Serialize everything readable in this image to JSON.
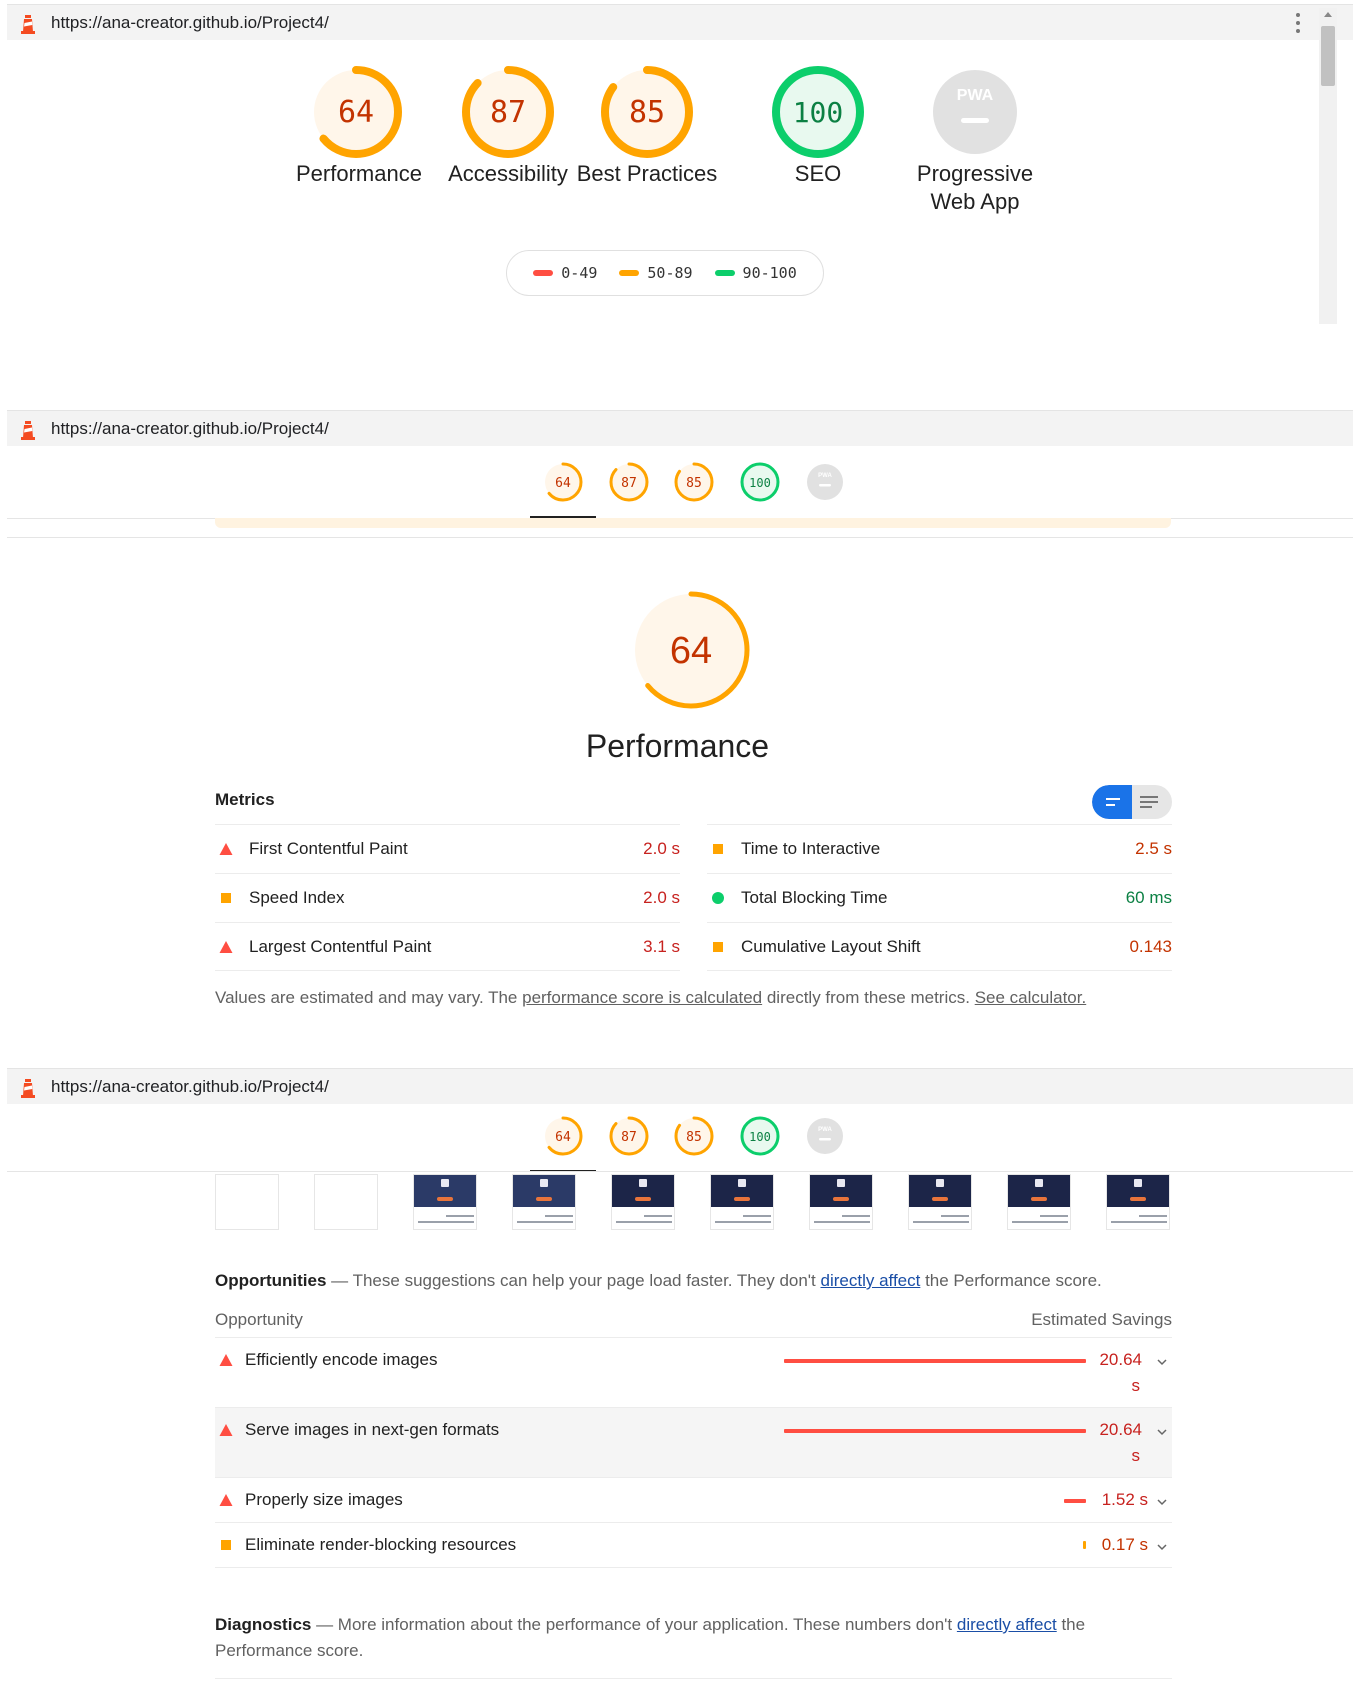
{
  "browser": {
    "url": "https://ana-creator.github.io/Project4/"
  },
  "scores": [
    {
      "value": 64,
      "display": "64",
      "label": "Performance",
      "color": "#ffa400"
    },
    {
      "value": 87,
      "display": "87",
      "label": "Accessibility",
      "color": "#ffa400"
    },
    {
      "value": 85,
      "display": "85",
      "label": "Best Practices",
      "color": "#ffa400"
    },
    {
      "value": 100,
      "display": "100",
      "label": "SEO",
      "color": "#0cce6b"
    },
    {
      "value": null,
      "display": "PWA",
      "label_line1": "Progressive",
      "label_line2": "Web App",
      "color": "#cccccc"
    }
  ],
  "legend": [
    {
      "range": "0-49",
      "color": "#ff4e42"
    },
    {
      "range": "50-89",
      "color": "#ffa400"
    },
    {
      "range": "90-100",
      "color": "#0cce6b"
    }
  ],
  "performance": {
    "score": "64",
    "score_value": 64,
    "title": "Performance",
    "metrics_heading": "Metrics",
    "metrics": [
      {
        "name": "First Contentful Paint",
        "value": "2.0 s",
        "status": "fail"
      },
      {
        "name": "Speed Index",
        "value": "2.0 s",
        "status": "average"
      },
      {
        "name": "Largest Contentful Paint",
        "value": "3.1 s",
        "status": "fail"
      },
      {
        "name": "Time to Interactive",
        "value": "2.5 s",
        "status": "average"
      },
      {
        "name": "Total Blocking Time",
        "value": "60 ms",
        "status": "pass"
      },
      {
        "name": "Cumulative Layout Shift",
        "value": "0.143",
        "status": "average"
      }
    ],
    "note_prefix": "Values are estimated and may vary. The ",
    "note_link1": "performance score is calculated",
    "note_middle": " directly from these metrics. ",
    "note_link2": "See calculator."
  },
  "opportunities": {
    "heading": "Opportunities",
    "desc_prefix": " — These suggestions can help your page load faster. They don't ",
    "desc_link": "directly affect",
    "desc_suffix": " the Performance score.",
    "col_left": "Opportunity",
    "col_right": "Estimated Savings",
    "items": [
      {
        "name": "Efficiently encode images",
        "savings_line1": "20.64",
        "savings_line2": "s",
        "status": "fail",
        "bar_fraction": 1.0
      },
      {
        "name": "Serve images in next-gen formats",
        "savings_line1": "20.64",
        "savings_line2": "s",
        "status": "fail",
        "bar_fraction": 1.0
      },
      {
        "name": "Properly size images",
        "savings": "1.52 s",
        "status": "fail",
        "bar_fraction": 0.074
      },
      {
        "name": "Eliminate render-blocking resources",
        "savings": "0.17 s",
        "status": "average",
        "bar_fraction": 0.008
      }
    ]
  },
  "diagnostics": {
    "heading": "Diagnostics",
    "desc_prefix": " — More information about the performance of your application. These numbers don't ",
    "desc_link": "directly affect",
    "desc_suffix": " the Performance score."
  },
  "colors": {
    "fail": "#ff4e42",
    "average": "#ffa400",
    "pass": "#0cce6b",
    "link": "#1a4ea6"
  }
}
